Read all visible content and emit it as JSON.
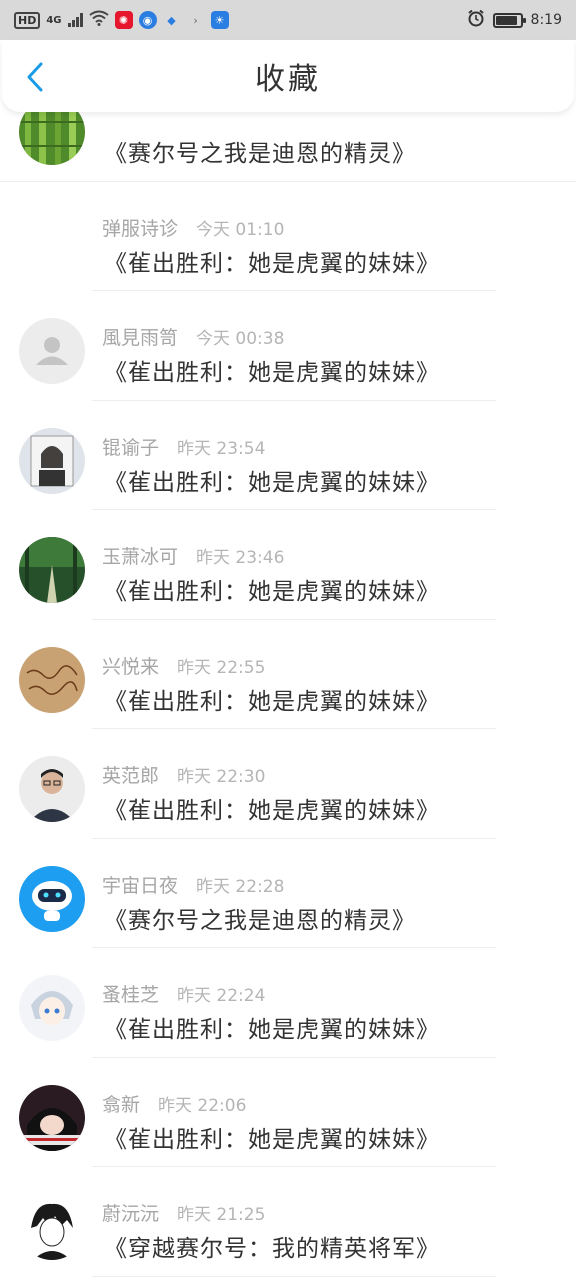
{
  "status_bar": {
    "hd": "HD",
    "network": "4G",
    "time": "8:19",
    "battery_level": 0.9
  },
  "header": {
    "title": "收藏",
    "back_icon": "chevron-left-icon",
    "accent_color": "#1a9be6"
  },
  "items": [
    {
      "name": "",
      "time": "",
      "message": "《赛尔号之我是迪恩的精灵》",
      "avatar": "bamboo"
    },
    {
      "name": "弹服诗诊",
      "time": "今天 01:10",
      "message": "《雈出胜利：她是虎翼的妹妹》",
      "avatar": "none"
    },
    {
      "name": "風見雨笥",
      "time": "今天 00:38",
      "message": "《雈出胜利：她是虎翼的妹妹》",
      "avatar": "default-user"
    },
    {
      "name": "锟谕子",
      "time": "昨天 23:54",
      "message": "《雈出胜利：她是虎翼的妹妹》",
      "avatar": "anime-girl"
    },
    {
      "name": "玉萧冰可",
      "time": "昨天 23:46",
      "message": "《雈出胜利：她是虎翼的妹妹》",
      "avatar": "forest-road"
    },
    {
      "name": "兴悦来",
      "time": "昨天 22:55",
      "message": "《雈出胜利：她是虎翼的妹妹》",
      "avatar": "handwriting"
    },
    {
      "name": "英范郎",
      "time": "昨天 22:30",
      "message": "《雈出胜利：她是虎翼的妹妹》",
      "avatar": "man-glasses"
    },
    {
      "name": "宇宙日夜",
      "time": "昨天 22:28",
      "message": "《赛尔号之我是迪恩的精灵》",
      "avatar": "robot"
    },
    {
      "name": "蚤桂芝",
      "time": "昨天 22:24",
      "message": "《雈出胜利：她是虎翼的妹妹》",
      "avatar": "anime-boy"
    },
    {
      "name": "翕新",
      "time": "昨天 22:06",
      "message": "《雈出胜利：她是虎翼的妹妹》",
      "avatar": "anime-dark"
    },
    {
      "name": "蔚沅沅",
      "time": "昨天 21:25",
      "message": "《穿越赛尔号：我的精英将军》",
      "avatar": "sketch-boy"
    }
  ]
}
